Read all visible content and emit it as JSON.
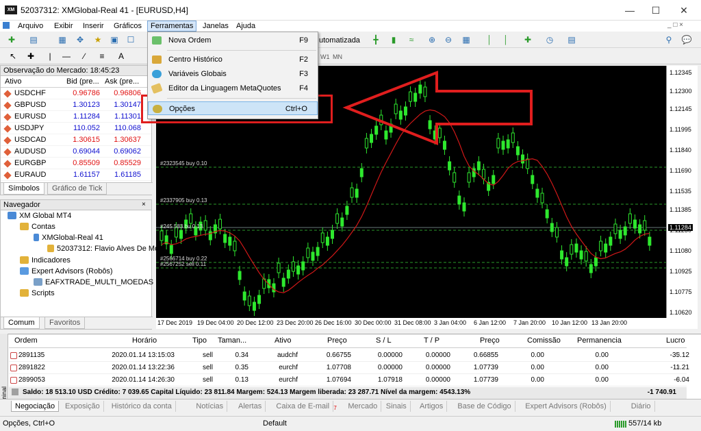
{
  "window": {
    "title": "52037312: XMGlobal-Real 41 - [EURUSD,H4]",
    "logo": "XM"
  },
  "menubar": [
    "Arquivo",
    "Exibir",
    "Inserir",
    "Gráficos",
    "Ferramentas",
    "Janelas",
    "Ajuda"
  ],
  "toolbar": {
    "autotrading_label": "utomatizada"
  },
  "toolbar2": {
    "periods": [
      "W1",
      "MN"
    ]
  },
  "dropdown": [
    {
      "label": "Nova Ordem",
      "key": "F9",
      "icon": "new-order-icon"
    },
    {
      "label": "Centro Histórico",
      "key": "F2",
      "icon": "history-center-icon"
    },
    {
      "label": "Variáveis Globais",
      "key": "F3",
      "icon": "global-variables-icon"
    },
    {
      "label": "Editor da Linguagem MetaQuotes",
      "key": "F4",
      "icon": "metaeditor-icon"
    },
    {
      "label": "Opções",
      "key": "Ctrl+O",
      "icon": "options-icon"
    }
  ],
  "market_watch": {
    "title": "Observação do Mercado: 18:45:23",
    "columns": [
      "Ativo",
      "Bid (pre...",
      "Ask (pre..."
    ],
    "rows": [
      {
        "symbol": "USDCHF",
        "bid": "0.96786",
        "ask": "0.96806",
        "color": "#e01010"
      },
      {
        "symbol": "GBPUSD",
        "bid": "1.30123",
        "ask": "1.30147",
        "color": "#1010d0"
      },
      {
        "symbol": "EURUSD",
        "bid": "1.11284",
        "ask": "1.11301",
        "color": "#1010d0"
      },
      {
        "symbol": "USDJPY",
        "bid": "110.052",
        "ask": "110.068",
        "color": "#1010d0"
      },
      {
        "symbol": "USDCAD",
        "bid": "1.30615",
        "ask": "1.30637",
        "color": "#e01010"
      },
      {
        "symbol": "AUDUSD",
        "bid": "0.69044",
        "ask": "0.69062",
        "color": "#1010d0"
      },
      {
        "symbol": "EURGBP",
        "bid": "0.85509",
        "ask": "0.85529",
        "color": "#e01010"
      },
      {
        "symbol": "EURAUD",
        "bid": "1.61157",
        "ask": "1.61185",
        "color": "#1010d0"
      }
    ],
    "tabs": [
      "Símbolos",
      "Gráfico de Tick"
    ]
  },
  "navigator": {
    "title": "Navegador",
    "items": [
      "XM Global MT4",
      "Contas",
      "XMGlobal-Real 41",
      "52037312: Flavio Alves De Mo",
      "Indicadores",
      "Expert Advisors (Robôs)",
      "EAFXTRADE_MULTI_MOEDAS",
      "Scripts"
    ],
    "tabs": [
      "Comum",
      "Favoritos"
    ]
  },
  "chart": {
    "price_labels": [
      "1.12345",
      "1.12300",
      "1.12145",
      "1.11995",
      "1.11840",
      "1.11690",
      "1.11535",
      "1.11385",
      "1.11230",
      "1.11080",
      "1.10925",
      "1.10775",
      "1.10620"
    ],
    "current_price": "1.11284",
    "time_labels": [
      "17 Dec 2019",
      "19 Dec 04:00",
      "20 Dec 12:00",
      "23 Dec 20:00",
      "26 Dec 16:00",
      "30 Dec 00:00",
      "31 Dec 08:00",
      "3 Jan 04:00",
      "6 Jan 12:00",
      "7 Jan 20:00",
      "10 Jan 12:00",
      "13 Jan 20:00"
    ],
    "order_lines": [
      "#2323545 buy 0.10",
      "#2337905 buy 0.13",
      "#245 583 bu 0.13",
      "#2566714 buy 0.22",
      "#2567252 sell 0.11"
    ]
  },
  "terminal": {
    "columns": [
      "Ordem",
      "Horário",
      "Tipo",
      "Taman...",
      "Ativo",
      "Preço",
      "S / L",
      "T / P",
      "Preço",
      "Comissão",
      "Permanencia",
      "Lucro"
    ],
    "rows": [
      [
        "2891135",
        "2020.01.14 13:15:03",
        "sell",
        "0.34",
        "audchf",
        "0.66755",
        "0.00000",
        "0.00000",
        "0.66855",
        "0.00",
        "0.00",
        "-35.12"
      ],
      [
        "2891822",
        "2020.01.14 13:22:36",
        "sell",
        "0.35",
        "eurchf",
        "1.07708",
        "0.00000",
        "0.00000",
        "1.07739",
        "0.00",
        "0.00",
        "-11.21"
      ],
      [
        "2899053",
        "2020.01.14 14:26:30",
        "sell",
        "0.13",
        "eurchf",
        "1.07694",
        "1.07918",
        "0.00000",
        "1.07739",
        "0.00",
        "0.00",
        "-6.04"
      ]
    ],
    "balance": "Saldo: 18 513.10 USD  Crédito: 7 039.65  Capital Líquido: 23 811.84  Margem: 524.13  Margem liberada: 23 287.71  Nível da margem: 4543.13%",
    "total_profit": "-1 740.91",
    "side_label": "Terminal",
    "tabs": [
      "Negociação",
      "Exposição",
      "Histórico da conta",
      "Notícias",
      "Alertas",
      "Caixa de E-mail",
      "Mercado",
      "Sinais",
      "Artigos",
      "Base de Código",
      "Expert Advisors (Robôs)",
      "Diário"
    ],
    "mail_badge": "7"
  },
  "status": {
    "hint": "Opções, Ctrl+O",
    "profile": "Default",
    "traffic": "557/14 kb"
  }
}
